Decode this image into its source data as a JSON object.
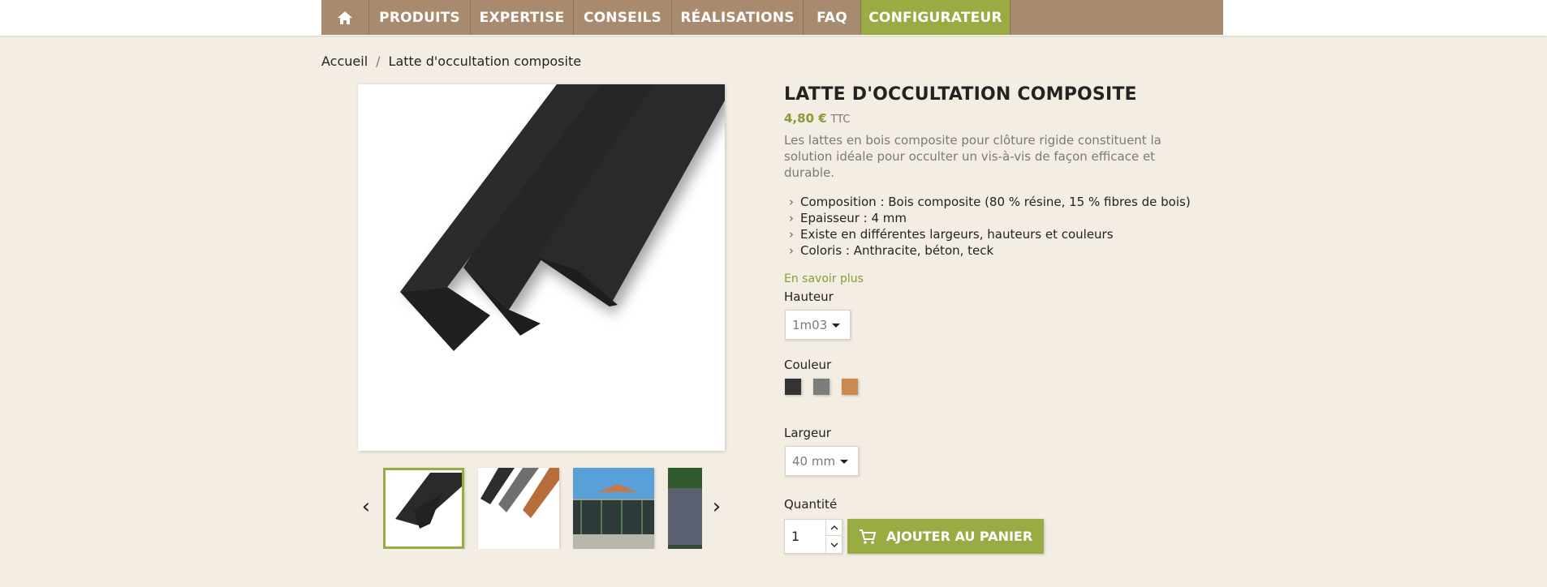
{
  "nav": {
    "home_icon": "home-icon",
    "items": [
      "PRODUITS",
      "EXPERTISE",
      "CONSEILS",
      "RÉALISATIONS",
      "FAQ",
      "CONFIGURATEUR"
    ],
    "accent_color": "#9aab44",
    "bar_color": "#a88b6f"
  },
  "breadcrumb": {
    "home": "Accueil",
    "separator": "/",
    "current": "Latte d'occultation composite"
  },
  "product": {
    "title": "LATTE D'OCCULTATION COMPOSITE",
    "price": "4,80 €",
    "price_suffix": "TTC",
    "description": "Les lattes en bois composite pour clôture rigide constituent la solution idéale pour occulter un vis-à-vis de façon efficace et durable.",
    "features": [
      "Composition : Bois composite (80 % résine, 15 % fibres de bois)",
      "Epaisseur : 4 mm",
      "Existe en différentes largeurs, hauteurs et couleurs",
      "Coloris : Anthracite, béton, teck"
    ],
    "more_link": "En savoir plus"
  },
  "options": {
    "height_label": "Hauteur",
    "height_value": "1m03",
    "color_label": "Couleur",
    "colors": [
      "#333333",
      "#7c7c7c",
      "#c98a4f"
    ],
    "width_label": "Largeur",
    "width_value": "40 mm",
    "quantity_label": "Quantité",
    "quantity_value": "1"
  },
  "cart": {
    "icon": "cart-icon",
    "label": "AJOUTER AU PANIER"
  },
  "gallery": {
    "prev_arrow": "‹",
    "next_arrow": "›",
    "thumbnails": [
      "black-slats",
      "three-color-slats",
      "fence-photo",
      "fence-closeup"
    ]
  }
}
